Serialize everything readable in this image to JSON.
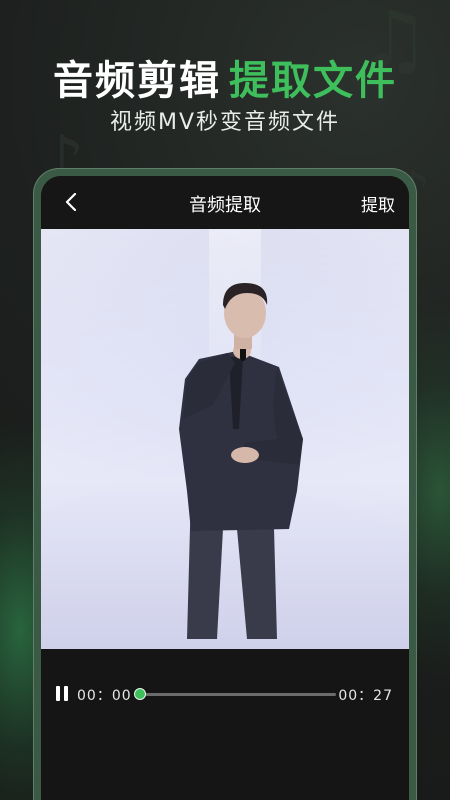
{
  "promo": {
    "headline_main": "音频剪辑",
    "headline_accent": "提取文件",
    "subline": "视频MV秒变音频文件"
  },
  "topbar": {
    "title": "音频提取",
    "action_label": "提取",
    "back_icon": "chevron-left-icon"
  },
  "player": {
    "current_time": "00：00",
    "total_time": "00：27",
    "progress": 0.0,
    "play_state_icon": "pause-icon"
  },
  "colors": {
    "accent": "#3fbf5c",
    "background": "#1b1d1c",
    "frame": "#3a5a45"
  }
}
